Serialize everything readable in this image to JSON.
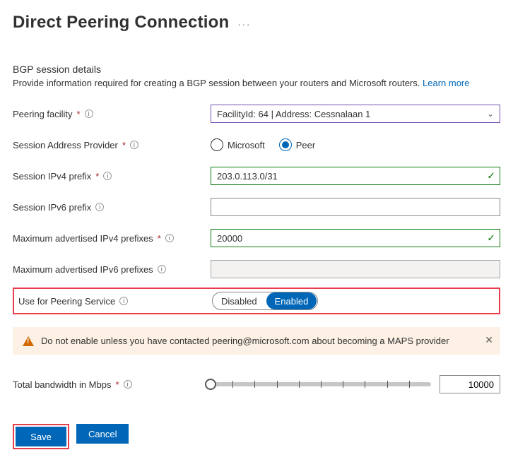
{
  "title": "Direct Peering Connection",
  "section": {
    "heading": "BGP session details",
    "description": "Provide information required for creating a BGP session between your routers and Microsoft routers.",
    "learn_more": "Learn more"
  },
  "fields": {
    "facility": {
      "label": "Peering facility",
      "value": "FacilityId: 64 | Address: Cessnalaan 1"
    },
    "session_provider": {
      "label": "Session Address Provider",
      "option_microsoft": "Microsoft",
      "option_peer": "Peer",
      "selected": "Peer"
    },
    "ipv4_prefix": {
      "label": "Session IPv4 prefix",
      "value": "203.0.113.0/31"
    },
    "ipv6_prefix": {
      "label": "Session IPv6 prefix",
      "value": ""
    },
    "max_ipv4": {
      "label": "Maximum advertised IPv4 prefixes",
      "value": "20000"
    },
    "max_ipv6": {
      "label": "Maximum advertised IPv6 prefixes",
      "value": ""
    },
    "peering_service": {
      "label": "Use for Peering Service",
      "disabled": "Disabled",
      "enabled": "Enabled",
      "selected": "Enabled"
    },
    "bandwidth": {
      "label": "Total bandwidth in Mbps",
      "value": "10000"
    }
  },
  "alert": {
    "text": "Do not enable unless you have contacted peering@microsoft.com about becoming a MAPS provider"
  },
  "buttons": {
    "save": "Save",
    "cancel": "Cancel"
  }
}
